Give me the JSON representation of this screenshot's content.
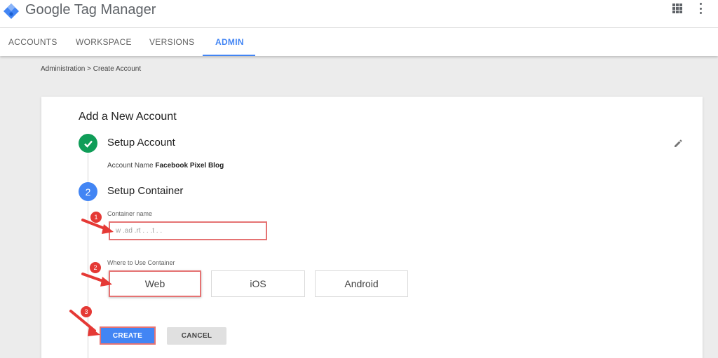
{
  "app": {
    "title": "Google Tag Manager"
  },
  "tabs": [
    {
      "label": "ACCOUNTS"
    },
    {
      "label": "WORKSPACE"
    },
    {
      "label": "VERSIONS"
    },
    {
      "label": "ADMIN",
      "active": true
    }
  ],
  "breadcrumb": "Administration > Create Account",
  "card": {
    "title": "Add a New Account",
    "step1": {
      "title": "Setup Account",
      "account_label": "Account Name",
      "account_value": "Facebook Pixel Blog"
    },
    "step2": {
      "number": "2",
      "title": "Setup Container",
      "container_label": "Container name",
      "container_value": "w   .ad  .rt       .  .  .t  .  .",
      "where_label": "Where to Use Container",
      "options": [
        {
          "label": "Web",
          "selected": true
        },
        {
          "label": "iOS"
        },
        {
          "label": "Android"
        }
      ]
    },
    "create_label": "CREATE",
    "cancel_label": "CANCEL"
  },
  "annotations": [
    "1",
    "2",
    "3"
  ],
  "colors": {
    "accent": "#4285f4",
    "success": "#0f9d58",
    "annotation": "#e53935"
  }
}
